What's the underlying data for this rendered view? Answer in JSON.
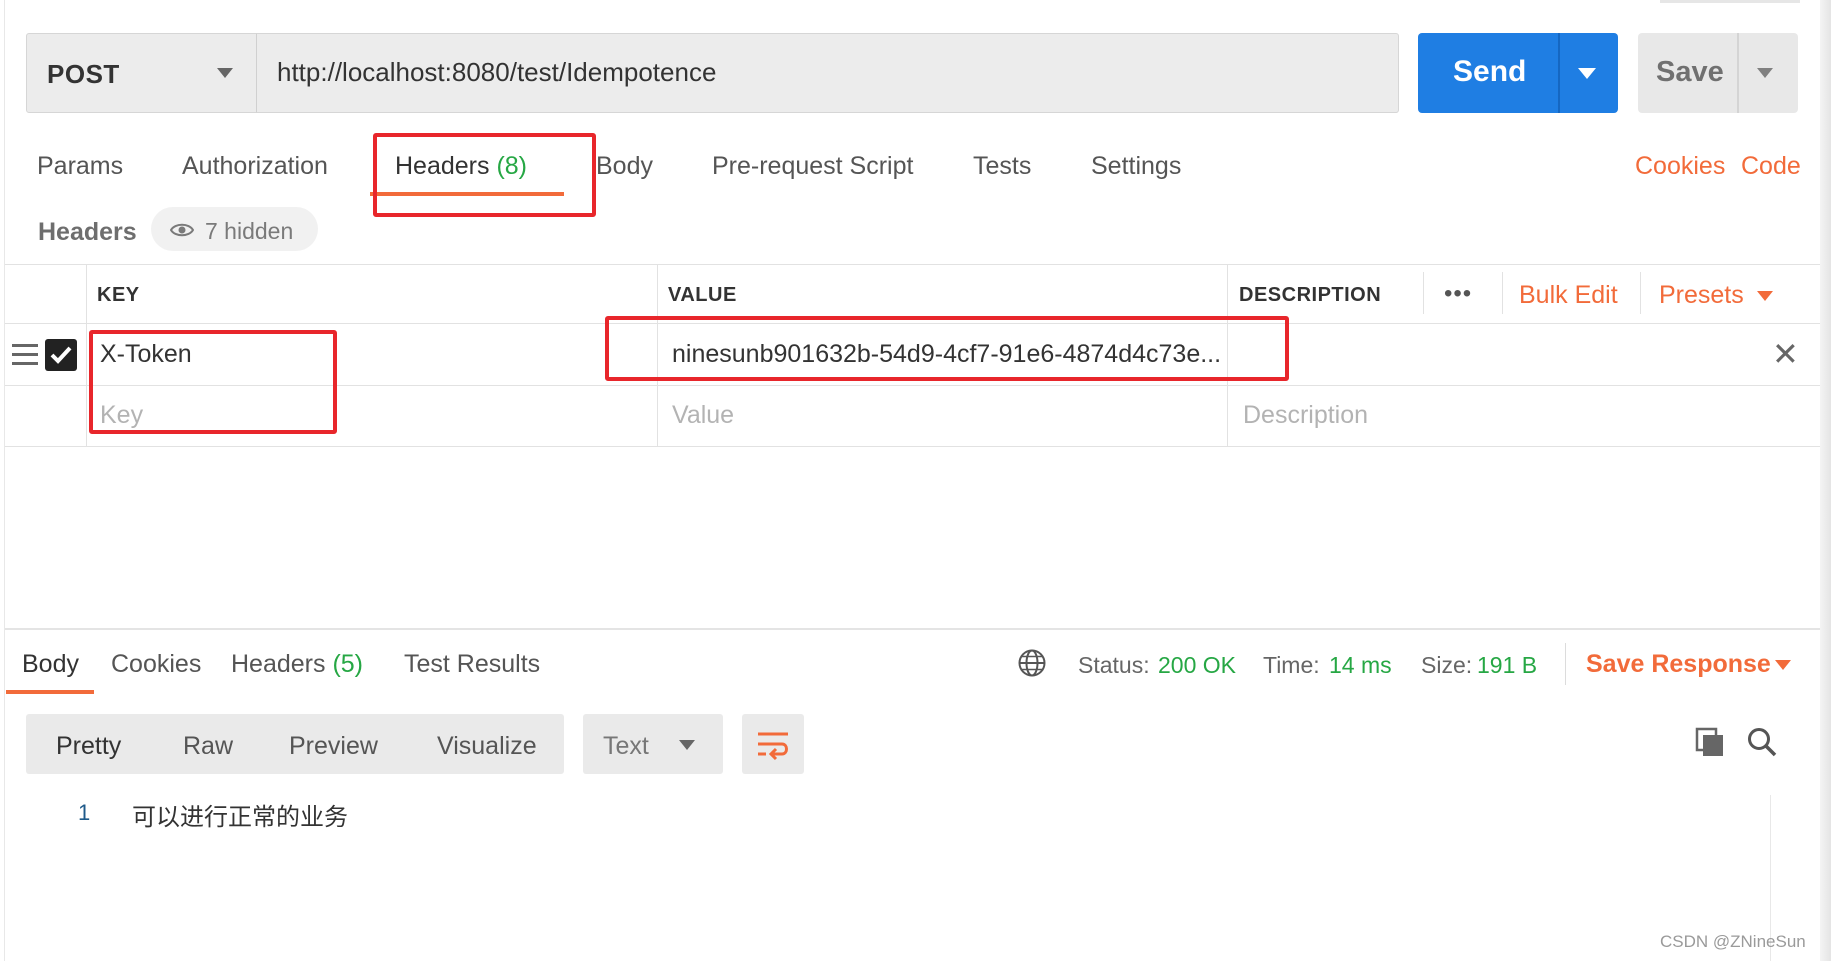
{
  "request": {
    "method": "POST",
    "url": "http://localhost:8080/test/Idempotence",
    "send_label": "Send",
    "save_label": "Save"
  },
  "request_tabs": {
    "params": "Params",
    "authorization": "Authorization",
    "headers": "Headers",
    "headers_count": "(8)",
    "body": "Body",
    "pre_request": "Pre-request Script",
    "tests": "Tests",
    "settings": "Settings",
    "cookies": "Cookies",
    "code": "Code"
  },
  "headers_section": {
    "title": "Headers",
    "hidden_label": "7 hidden",
    "columns": {
      "key": "KEY",
      "value": "VALUE",
      "description": "DESCRIPTION"
    },
    "more_label": "•••",
    "bulk_edit": "Bulk Edit",
    "presets": "Presets",
    "rows": [
      {
        "key": "X-Token",
        "value": "ninesunb901632b-54d9-4cf7-91e6-4874d4c73e...",
        "description": "",
        "checked": true
      }
    ],
    "placeholders": {
      "key": "Key",
      "value": "Value",
      "description": "Description"
    }
  },
  "response_tabs": {
    "body": "Body",
    "cookies": "Cookies",
    "headers": "Headers",
    "headers_count": "(5)",
    "test_results": "Test Results"
  },
  "response_status": {
    "status_label": "Status:",
    "status_value": "200 OK",
    "time_label": "Time:",
    "time_value": "14 ms",
    "size_label": "Size:",
    "size_value": "191 B",
    "save_response": "Save Response"
  },
  "body_formats": {
    "pretty": "Pretty",
    "raw": "Raw",
    "preview": "Preview",
    "visualize": "Visualize",
    "type": "Text"
  },
  "response_body": {
    "lines": [
      {
        "number": "1",
        "text": "可以进行正常的业务"
      }
    ]
  },
  "watermark": "CSDN @ZNineSun",
  "colors": {
    "accent": "#f26b3a",
    "send": "#1f7ee3",
    "success": "#26a744",
    "annotation": "#e8262b"
  }
}
